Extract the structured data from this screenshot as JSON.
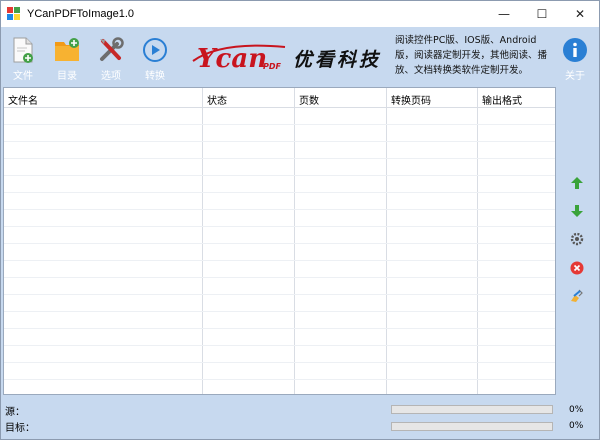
{
  "window": {
    "title": "YCanPDFToImage1.0",
    "minimize_glyph": "—",
    "maximize_glyph": "☐",
    "close_glyph": "✕"
  },
  "toolbar": {
    "file_label": "文件",
    "folder_label": "目录",
    "options_label": "选项",
    "convert_label": "转换",
    "about_label": "关于"
  },
  "brand": {
    "logo_text": "Ycan",
    "logo_sub": "PDF",
    "name": "优看科技",
    "description": "阅读控件PC版、IOS版、Android版，阅读器定制开发，其他阅读、播放、文档转换类软件定制开发。"
  },
  "table": {
    "columns": [
      "文件名",
      "状态",
      "页数",
      "转换页码",
      "输出格式"
    ]
  },
  "side_actions": [
    "move-up-icon",
    "move-down-icon",
    "settings-icon",
    "delete-icon",
    "clear-icon"
  ],
  "status": {
    "source_label": "源：",
    "target_label": "目标：",
    "source_progress": 0,
    "target_progress": 0,
    "source_percent": "0%",
    "target_percent": "0%"
  },
  "colors": {
    "background": "#c7d9ef",
    "logo_red": "#c8141e",
    "info_blue": "#2a7fd4",
    "progress_green": "#06b025"
  }
}
